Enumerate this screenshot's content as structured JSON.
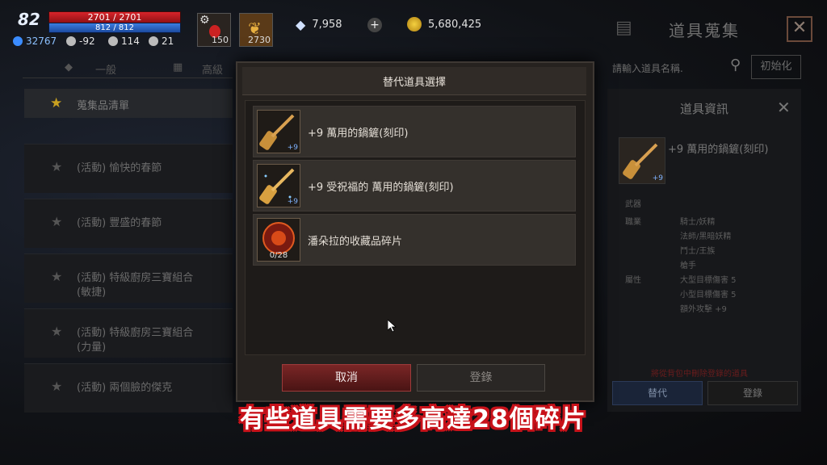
{
  "hud": {
    "level": "82",
    "hp": "2701 / 2701",
    "mp": "812 / 812",
    "stats": [
      "32767",
      "-92",
      "114",
      "21"
    ],
    "slot1_count": "150",
    "slot2_count": "2730",
    "currency_crystal": "7,958",
    "currency_plus": "+",
    "currency_gold": "5,680,425"
  },
  "background": {
    "title": "道具蒐集",
    "tabs": [
      "一般",
      "高級"
    ],
    "list_header": "蒐集品清單",
    "list_items": [
      "(活動) 愉快的春節",
      "(活動) 豐盛的春節",
      "(活動) 特級廚房三寶組合\n(敏捷)",
      "(活動) 特級廚房三寶組合\n(力量)",
      "(活動) 兩個臉的傑克"
    ],
    "search_placeholder": "請輸入道具名稱.",
    "reset_label": "初始化"
  },
  "info_panel": {
    "title": "道具資訊",
    "item_name": "+9 萬用的鍋鏟(刻印)",
    "item_badge": "+9",
    "type_label": "武器",
    "class_label": "職業",
    "classes": [
      "騎士/妖精",
      "法師/黑暗妖精",
      "鬥士/王族",
      "槍手"
    ],
    "attr_label": "屬性",
    "attrs": [
      "大型目標傷害 5",
      "小型目標傷害 5",
      "額外攻擊 +9"
    ],
    "warning": "將從背包中刪除登錄的道具",
    "substitute_label": "替代",
    "register_label": "登錄"
  },
  "modal": {
    "title": "替代道具選擇",
    "items": [
      {
        "name": "+9 萬用的鍋鏟(刻印)",
        "badge": "+9"
      },
      {
        "name": "+9 受祝福的 萬用的鍋鏟(刻印)",
        "badge": "+9"
      },
      {
        "name": "潘朵拉的收藏品碎片",
        "count": "0/28"
      }
    ],
    "cancel_label": "取消",
    "register_label": "登錄"
  },
  "subtitle": "有些道具需要多高達28個碎片",
  "colors": {
    "accent_red": "#c8121a",
    "hp_red": "#d8242a",
    "mp_blue": "#3b7de0",
    "gold": "#e0b020"
  }
}
